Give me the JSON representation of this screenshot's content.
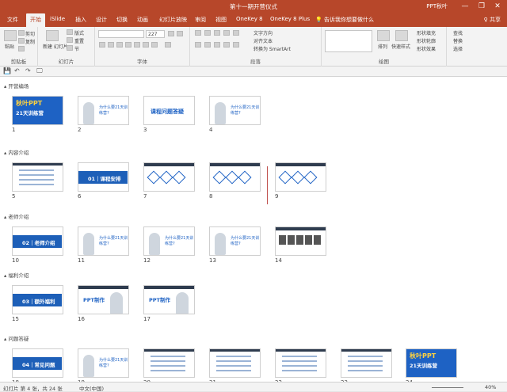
{
  "window": {
    "title": "第十一期开营仪式",
    "account": "PPT秋叶",
    "minimize": "—",
    "restore": "❐",
    "close": "✕"
  },
  "tabs": [
    "文件",
    "开始",
    "iSlide",
    "插入",
    "设计",
    "切换",
    "动画",
    "幻灯片放映",
    "审阅",
    "视图",
    "OneKey 8",
    "OneKey 8 Plus",
    "告诉我你想要做什么"
  ],
  "share": "♀ 共享",
  "ribbon": {
    "groups": [
      "剪贴板",
      "幻灯片",
      "字体",
      "段落",
      "绘图"
    ],
    "clipboard": {
      "paste": "粘贴",
      "cut": "剪切",
      "copy": "复制",
      "format_painter": "格式刷"
    },
    "slides": {
      "new_slide": "新建\n幻灯片",
      "layout": "版式",
      "reset": "重置",
      "section": "节"
    },
    "font": {
      "font_size": "227"
    },
    "paragraph": {
      "text_direction": "文字方向",
      "align_text": "对齐文本",
      "smartart": "转换为 SmartArt"
    },
    "drawing": {
      "arrange": "排列",
      "quick_styles": "快速样式",
      "fill": "形状填充",
      "outline": "形状轮廓",
      "effects": "形状效果"
    },
    "editing": {
      "find": "查找",
      "replace": "替换",
      "select": "选择"
    }
  },
  "qat": [
    "💾",
    "↶",
    "↷",
    "🖵"
  ],
  "sections": [
    {
      "name": "开营编场",
      "slides": [
        {
          "n": "1",
          "kind": "cover"
        },
        {
          "n": "2",
          "kind": "person"
        },
        {
          "n": "3",
          "kind": "text"
        },
        {
          "n": "4",
          "kind": "person"
        }
      ]
    },
    {
      "name": "内容介绍",
      "slides": [
        {
          "n": "5",
          "kind": "list"
        },
        {
          "n": "6",
          "kind": "divider",
          "label": "01｜课程安排"
        },
        {
          "n": "7",
          "kind": "diamond"
        },
        {
          "n": "8",
          "kind": "diamond"
        },
        {
          "n": "9",
          "kind": "diamond"
        }
      ]
    },
    {
      "name": "老师介绍",
      "slides": [
        {
          "n": "10",
          "kind": "divider",
          "label": "02｜老师介绍"
        },
        {
          "n": "11",
          "kind": "person"
        },
        {
          "n": "12",
          "kind": "person"
        },
        {
          "n": "13",
          "kind": "person"
        },
        {
          "n": "14",
          "kind": "group"
        }
      ]
    },
    {
      "name": "福利介绍",
      "slides": [
        {
          "n": "15",
          "kind": "divider",
          "label": "03｜额外福利"
        },
        {
          "n": "16",
          "kind": "promo"
        },
        {
          "n": "17",
          "kind": "promo"
        }
      ]
    },
    {
      "name": "问题答疑",
      "slides": [
        {
          "n": "18",
          "kind": "divider",
          "label": "04｜常见问题"
        },
        {
          "n": "19",
          "kind": "person"
        },
        {
          "n": "20",
          "kind": "list"
        },
        {
          "n": "21",
          "kind": "list"
        },
        {
          "n": "22",
          "kind": "list"
        },
        {
          "n": "23",
          "kind": "list"
        },
        {
          "n": "24",
          "kind": "cover"
        }
      ]
    }
  ],
  "slide_text": {
    "cover_title": "秋叶PPT",
    "cover_sub": "21天训练营",
    "qa_title": "为什么要21天训练营?",
    "slide3_text": "课程问题答疑",
    "promo_title": "PPT制作"
  },
  "status": {
    "slide": "幻灯片 第 4 张，共 24 张",
    "language": "中文(中国)",
    "zoom": "40%"
  }
}
